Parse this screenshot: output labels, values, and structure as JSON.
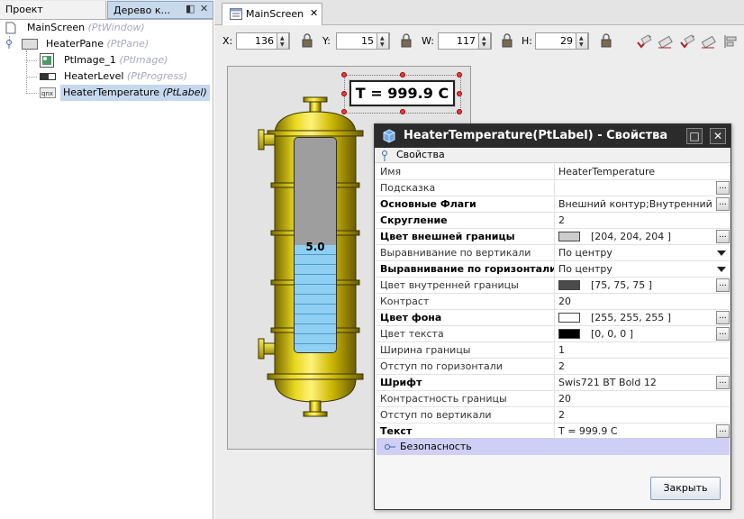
{
  "left_panel": {
    "tabs": [
      "Проект",
      "Дерево к..."
    ],
    "tree": [
      {
        "name": "MainScreen",
        "type": "(PtWindow)"
      },
      {
        "name": "HeaterPane",
        "type": "(PtPane)"
      },
      {
        "name": "PtImage_1",
        "type": "(PtImage)"
      },
      {
        "name": "HeaterLevel",
        "type": "(PtProgress)"
      },
      {
        "name": "HeaterTemperature",
        "type": "(PtLabel)"
      }
    ]
  },
  "doc_tab": {
    "label": "MainScreen",
    "close": "✕"
  },
  "toolbar": {
    "x_label": "X:",
    "x_value": "136",
    "y_label": "Y:",
    "y_value": "15",
    "w_label": "W:",
    "w_value": "117",
    "h_label": "H:",
    "h_value": "29"
  },
  "canvas": {
    "temperature_text": "T = 999.9 C",
    "level_text": "5.0",
    "level_fraction": 0.5
  },
  "dialog": {
    "title": "HeaterTemperature(PtLabel) - Свойства",
    "section_props": "Свойства",
    "section_security": "Безопасность",
    "close_button": "Закрыть",
    "props": [
      {
        "name": "Имя",
        "value": "HeaterTemperature"
      },
      {
        "name": "Подсказка",
        "value": ""
      },
      {
        "name": "Основные Флаги",
        "value": "Внешний контур;Внутренний к..."
      },
      {
        "name": "Скругление",
        "value": "2"
      },
      {
        "name": "Цвет внешней границы",
        "value": "[204, 204, 204 ]",
        "color": "#cccccc"
      },
      {
        "name": "Выравнивание по вертикали",
        "value": "По центру"
      },
      {
        "name": "Выравнивание по горизонтали",
        "value": "По центру"
      },
      {
        "name": "Цвет внутренней границы",
        "value": "[75, 75, 75 ]",
        "color": "#4b4b4b"
      },
      {
        "name": "Контраст",
        "value": "20"
      },
      {
        "name": "Цвет фона",
        "value": "[255, 255, 255 ]",
        "color": "#ffffff"
      },
      {
        "name": "Цвет текста",
        "value": "[0, 0, 0 ]",
        "color": "#000000"
      },
      {
        "name": "Ширина границы",
        "value": "1"
      },
      {
        "name": "Отступ по горизонтали",
        "value": "2"
      },
      {
        "name": "Шрифт",
        "value": "Swis721 BT Bold 12"
      },
      {
        "name": "Контрастность границы",
        "value": "20"
      },
      {
        "name": "Отступ по вертикали",
        "value": "2"
      },
      {
        "name": "Текст",
        "value": "T = 999.9 C"
      }
    ]
  },
  "colors": {
    "heater_body": "#c8b400",
    "liquid": "#8fd0f2",
    "selection_tree": "#c6d8ee",
    "security_band": "#cfcff5"
  }
}
